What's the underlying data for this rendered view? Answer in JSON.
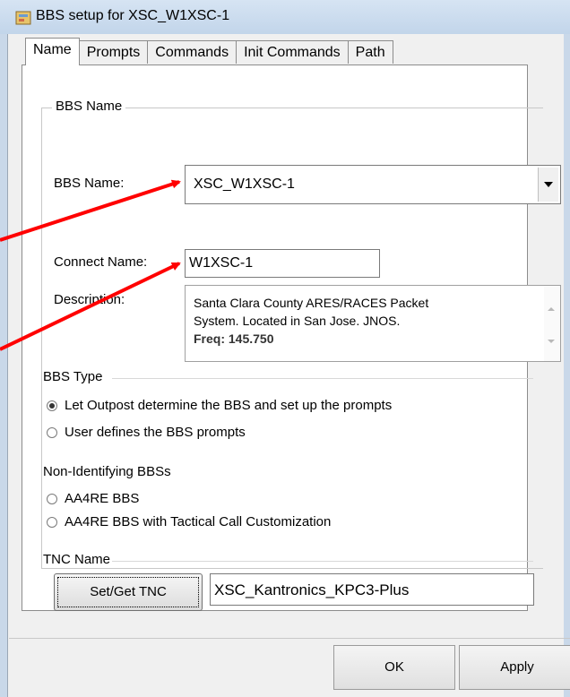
{
  "window": {
    "title": "BBS setup for XSC_W1XSC-1"
  },
  "tabs": [
    {
      "label": "Name",
      "active": true
    },
    {
      "label": "Prompts",
      "active": false
    },
    {
      "label": "Commands",
      "active": false
    },
    {
      "label": "Init Commands",
      "active": false
    },
    {
      "label": "Path",
      "active": false
    }
  ],
  "group": {
    "title": "BBS Name"
  },
  "bbs_name": {
    "label": "BBS Name:",
    "value": "XSC_W1XSC-1"
  },
  "connect_name": {
    "label": "Connect Name:",
    "value": "W1XSC-1"
  },
  "description": {
    "label": "Description:",
    "line1": "Santa Clara County ARES/RACES Packet",
    "line2": "System.  Located in San Jose.  JNOS.",
    "line3": "Freq: 145.750"
  },
  "bbs_type": {
    "label": "BBS Type",
    "option1": "Let Outpost determine the BBS and set up the prompts",
    "option2": "User defines the BBS prompts",
    "selected": "option1"
  },
  "non_identifying": {
    "label": "Non-Identifying BBSs",
    "option1": "AA4RE BBS",
    "option2": "AA4RE BBS with Tactical Call Customization"
  },
  "tnc": {
    "label": "TNC Name",
    "button": "Set/Get TNC",
    "value": "XSC_Kantronics_KPC3-Plus"
  },
  "footer": {
    "ok": "OK",
    "apply": "Apply"
  },
  "colors": {
    "annotation_arrow": "#ff0000",
    "title_bar": "#c9d8e9"
  }
}
